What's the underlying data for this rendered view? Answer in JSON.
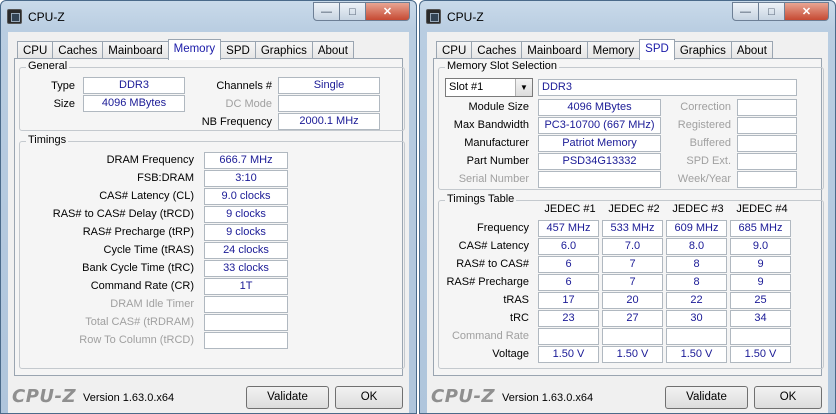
{
  "left": {
    "title": "CPU-Z",
    "tabs": [
      "CPU",
      "Caches",
      "Mainboard",
      "Memory",
      "SPD",
      "Graphics",
      "About"
    ],
    "general": {
      "label": "General",
      "type_label": "Type",
      "type": "DDR3",
      "size_label": "Size",
      "size": "4096 MBytes",
      "channels_label": "Channels #",
      "channels": "Single",
      "dcmode_label": "DC Mode",
      "dcmode": "",
      "nbfreq_label": "NB Frequency",
      "nbfreq": "2000.1 MHz"
    },
    "timings": {
      "label": "Timings",
      "rows": [
        {
          "label": "DRAM Frequency",
          "value": "666.7 MHz"
        },
        {
          "label": "FSB:DRAM",
          "value": "3:10"
        },
        {
          "label": "CAS# Latency (CL)",
          "value": "9.0 clocks"
        },
        {
          "label": "RAS# to CAS# Delay (tRCD)",
          "value": "9 clocks"
        },
        {
          "label": "RAS# Precharge (tRP)",
          "value": "9 clocks"
        },
        {
          "label": "Cycle Time (tRAS)",
          "value": "24 clocks"
        },
        {
          "label": "Bank Cycle Time (tRC)",
          "value": "33 clocks"
        },
        {
          "label": "Command Rate (CR)",
          "value": "1T"
        },
        {
          "label": "DRAM Idle Timer",
          "value": ""
        },
        {
          "label": "Total CAS# (tRDRAM)",
          "value": ""
        },
        {
          "label": "Row To Column (tRCD)",
          "value": ""
        }
      ]
    },
    "footer": {
      "brand": "CPU-Z",
      "version": "Version 1.63.0.x64",
      "validate": "Validate",
      "ok": "OK"
    }
  },
  "right": {
    "title": "CPU-Z",
    "tabs": [
      "CPU",
      "Caches",
      "Mainboard",
      "Memory",
      "SPD",
      "Graphics",
      "About"
    ],
    "slot": {
      "label": "Memory Slot Selection",
      "selected": "Slot #1",
      "type": "DDR3",
      "module_size_label": "Module Size",
      "module_size": "4096 MBytes",
      "max_bw_label": "Max Bandwidth",
      "max_bw": "PC3-10700 (667 MHz)",
      "manufacturer_label": "Manufacturer",
      "manufacturer": "Patriot Memory",
      "part_label": "Part Number",
      "part": "PSD34G13332",
      "serial_label": "Serial Number",
      "serial": "",
      "correction_label": "Correction",
      "registered_label": "Registered",
      "buffered_label": "Buffered",
      "spdext_label": "SPD Ext.",
      "weekyear_label": "Week/Year"
    },
    "timings_table": {
      "label": "Timings Table",
      "headers": [
        "JEDEC #1",
        "JEDEC #2",
        "JEDEC #3",
        "JEDEC #4"
      ],
      "rows": [
        {
          "label": "Frequency",
          "values": [
            "457 MHz",
            "533 MHz",
            "609 MHz",
            "685 MHz"
          ]
        },
        {
          "label": "CAS# Latency",
          "values": [
            "6.0",
            "7.0",
            "8.0",
            "9.0"
          ]
        },
        {
          "label": "RAS# to CAS#",
          "values": [
            "6",
            "7",
            "8",
            "9"
          ]
        },
        {
          "label": "RAS# Precharge",
          "values": [
            "6",
            "7",
            "8",
            "9"
          ]
        },
        {
          "label": "tRAS",
          "values": [
            "17",
            "20",
            "22",
            "25"
          ]
        },
        {
          "label": "tRC",
          "values": [
            "23",
            "27",
            "30",
            "34"
          ]
        },
        {
          "label": "Command Rate",
          "values": [
            "",
            "",
            "",
            ""
          ]
        },
        {
          "label": "Voltage",
          "values": [
            "1.50 V",
            "1.50 V",
            "1.50 V",
            "1.50 V"
          ]
        }
      ]
    },
    "footer": {
      "brand": "CPU-Z",
      "version": "Version 1.63.0.x64",
      "validate": "Validate",
      "ok": "OK"
    }
  },
  "colors": {
    "value_text": "#1a1a96",
    "active_tab": "#1a1aa8",
    "frame": "#b9cde1"
  }
}
